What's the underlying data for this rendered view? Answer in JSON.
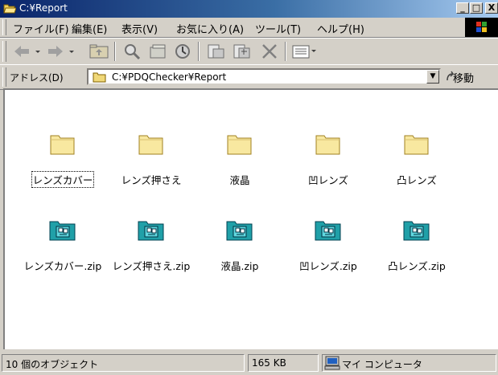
{
  "window": {
    "title": "C:¥Report",
    "buttons": {
      "minimize": "_",
      "maximize": "□",
      "close": "X"
    }
  },
  "menubar": {
    "items": [
      "ファイル(F)",
      "編集(E)",
      "表示(V)",
      "お気に入り(A)",
      "ツール(T)",
      "ヘルプ(H)"
    ]
  },
  "toolbar": {
    "buttons": [
      "back-icon",
      "forward-icon",
      "up-folder-icon",
      "search-icon",
      "folders-icon",
      "history-icon",
      "move-to-icon",
      "copy-to-icon",
      "delete-icon",
      "views-icon"
    ]
  },
  "address": {
    "label": "アドレス(D)",
    "path": "C:¥PDQChecker¥Report",
    "go_label": "移動"
  },
  "files": [
    {
      "name": "レンズカバー",
      "type": "folder"
    },
    {
      "name": "レンズ押さえ",
      "type": "folder"
    },
    {
      "name": "液晶",
      "type": "folder"
    },
    {
      "name": "凹レンズ",
      "type": "folder"
    },
    {
      "name": "凸レンズ",
      "type": "folder"
    },
    {
      "name": "レンズカバー.zip",
      "type": "zip"
    },
    {
      "name": "レンズ押さえ.zip",
      "type": "zip"
    },
    {
      "name": "液晶.zip",
      "type": "zip"
    },
    {
      "name": "凹レンズ.zip",
      "type": "zip"
    },
    {
      "name": "凸レンズ.zip",
      "type": "zip"
    }
  ],
  "status": {
    "objects": "10 個のオブジェクト",
    "size": "165 KB",
    "zone": "マイ コンピュータ"
  }
}
